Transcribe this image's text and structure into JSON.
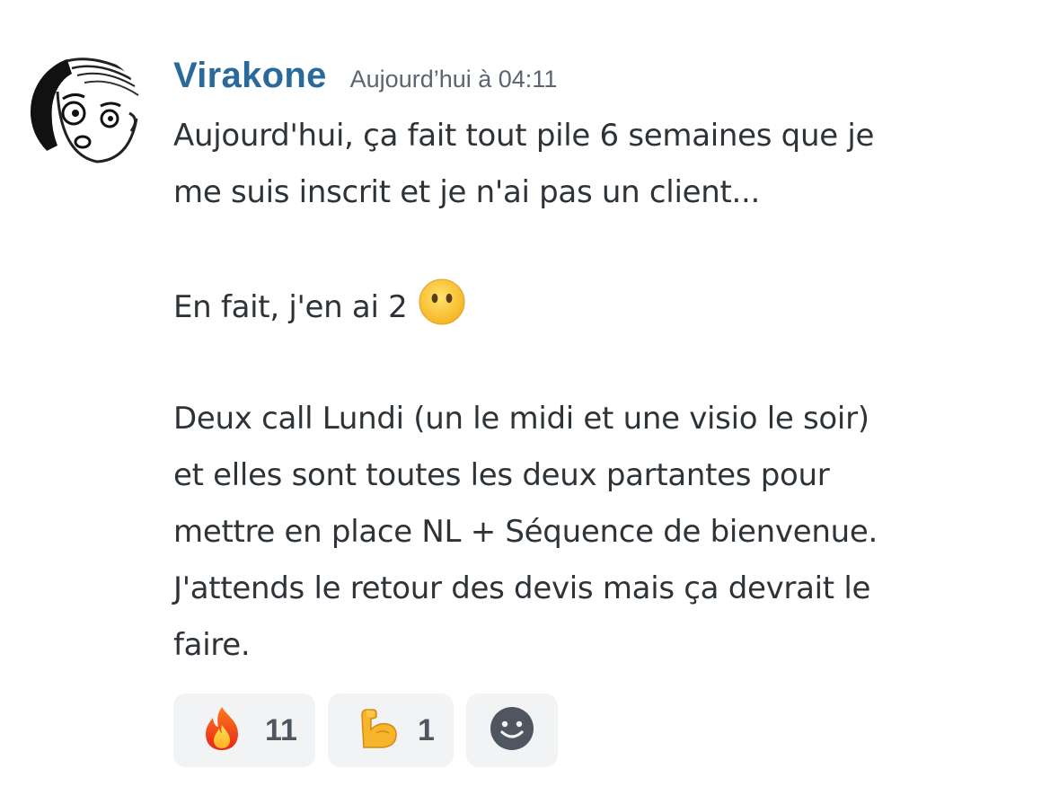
{
  "message": {
    "username": "Virakone",
    "timestamp": "Aujourd’hui à 04:11",
    "lines": [
      "Aujourd'hui, ça fait tout pile 6 semaines que je",
      "me suis inscrit et je n'ai pas un client...",
      "",
      "En fait, j'en ai 2",
      "",
      "Deux call Lundi (un le midi et une visio le soir)",
      "et elles sont toutes les deux partantes pour",
      "mettre en place NL + Séquence de bienvenue.",
      "J'attends le retour des devis mais ça devrait le",
      "faire."
    ],
    "inline_emoji": "face-without-mouth"
  },
  "reactions": [
    {
      "emoji": "fire-emoji",
      "count": "11"
    },
    {
      "emoji": "flexed-biceps-emoji",
      "count": "1"
    },
    {
      "emoji": "add-reaction-icon"
    }
  ],
  "colors": {
    "username": "#2a6a9a",
    "timestamp": "#5c6470",
    "text": "#2e3338",
    "reaction_bg": "#f2f3f5",
    "reaction_count": "#4f5660"
  }
}
